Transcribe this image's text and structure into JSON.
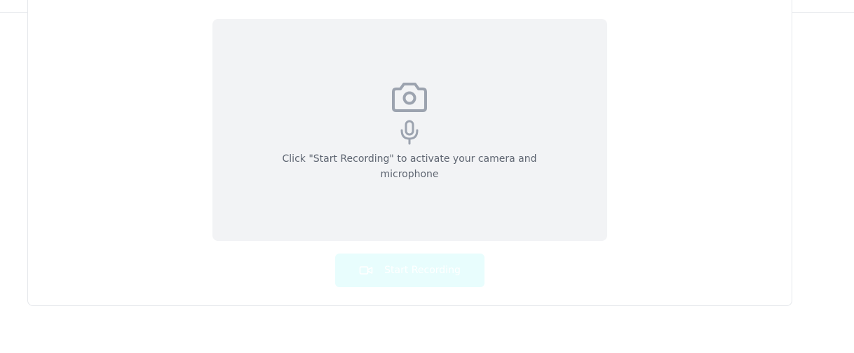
{
  "preview": {
    "camera_icon": "camera-icon",
    "mic_icon": "microphone-icon",
    "hint_text": "Click \"Start Recording\" to activate your camera and microphone"
  },
  "actions": {
    "record_label": "Start Recording",
    "record_icon": "video-icon",
    "record_bg_color": "#e8fdfd"
  },
  "colors": {
    "preview_bg": "#f2f3f5",
    "icon_gray": "#9ca3af",
    "hint_text": "#5f6672"
  }
}
